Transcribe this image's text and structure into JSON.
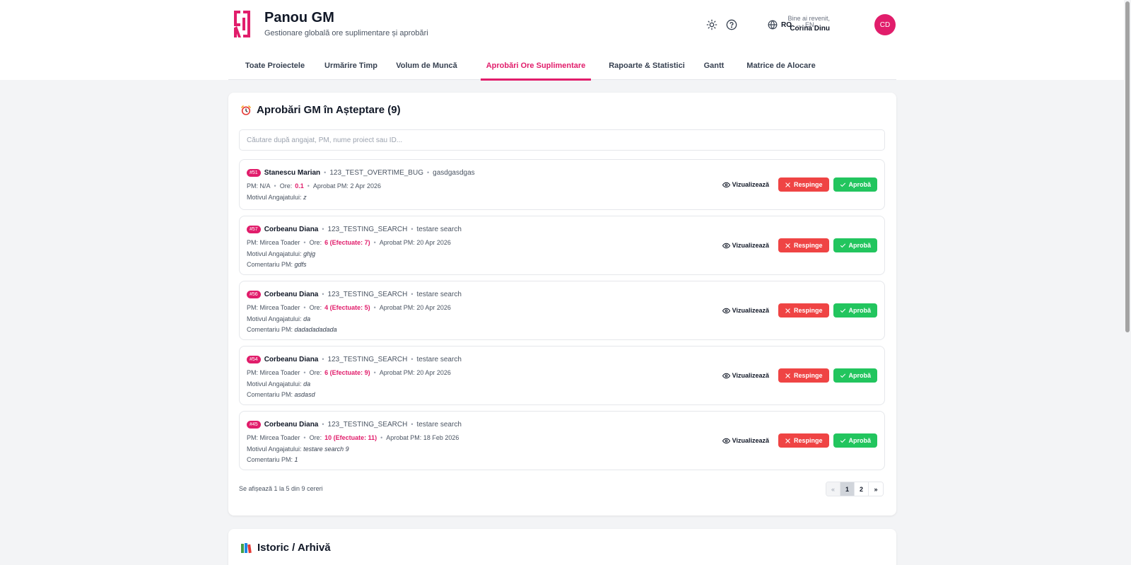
{
  "app": {
    "title": "Panou GM",
    "subtitle": "Gestionare globală ore suplimentare și aprobări"
  },
  "header": {
    "lang_current": "RO",
    "lang_arrow": "→",
    "lang_other": "EN",
    "welcome_text": "Bine ai revenit,",
    "user_name": "Corina Dinu",
    "user_initials": "CD"
  },
  "tabs": [
    {
      "label": "Toate Proiectele"
    },
    {
      "label": "Urmărire Timp"
    },
    {
      "label": "Volum de Muncă"
    },
    {
      "label": "Aprobări Ore Suplimentare",
      "active": true
    },
    {
      "label": "Rapoarte & Statistici"
    },
    {
      "label": "Gantt"
    },
    {
      "label": "Matrice de Alocare"
    }
  ],
  "pending": {
    "title": "Aprobări GM în Așteptare (9)",
    "search_placeholder": "Căutare după angajat, PM, nume proiect sau ID...",
    "labels": {
      "pm": "PM:",
      "hours": "Ore:",
      "pm_approved": "Aprobat PM:",
      "employee_reason": "Motivul Angajatului:",
      "pm_comment": "Comentariu PM:",
      "view": "Vizualizează",
      "reject": "Respinge",
      "approve": "Aprobă"
    },
    "requests": [
      {
        "id": "#51",
        "employee": "Stanescu Marian",
        "project": "123_TEST_OVERTIME_BUG",
        "task": "gasdgasdgas",
        "pm": "N/A",
        "hours": "0.1",
        "pm_date": "2 Apr 2026",
        "reason": "z",
        "comment": ""
      },
      {
        "id": "#57",
        "employee": "Corbeanu Diana",
        "project": "123_TESTING_SEARCH",
        "task": "testare search",
        "pm": "Mircea Toader",
        "hours": "6 (Efectuate: 7)",
        "pm_date": "20 Apr 2026",
        "reason": "ghjg",
        "comment": "gdfs"
      },
      {
        "id": "#56",
        "employee": "Corbeanu Diana",
        "project": "123_TESTING_SEARCH",
        "task": "testare search",
        "pm": "Mircea Toader",
        "hours": "4 (Efectuate: 5)",
        "pm_date": "20 Apr 2026",
        "reason": "da",
        "comment": "dadadadadada"
      },
      {
        "id": "#54",
        "employee": "Corbeanu Diana",
        "project": "123_TESTING_SEARCH",
        "task": "testare search",
        "pm": "Mircea Toader",
        "hours": "6 (Efectuate: 9)",
        "pm_date": "20 Apr 2026",
        "reason": "da",
        "comment": "asdasd"
      },
      {
        "id": "#45",
        "employee": "Corbeanu Diana",
        "project": "123_TESTING_SEARCH",
        "task": "testare search",
        "pm": "Mircea Toader",
        "hours": "10 (Efectuate: 11)",
        "pm_date": "18 Feb 2026",
        "reason": "testare search 9",
        "comment": "1"
      }
    ],
    "showing": "Se afișează 1 la 5 din 9 cereri",
    "pagination": {
      "prev": "«",
      "pages": [
        "1",
        "2"
      ],
      "next": "»",
      "current": "1"
    }
  },
  "archive": {
    "title": "Istoric / Arhivă"
  },
  "colors": {
    "accent": "#e11d6b",
    "reject": "#ef4444",
    "approve": "#22c55e"
  }
}
